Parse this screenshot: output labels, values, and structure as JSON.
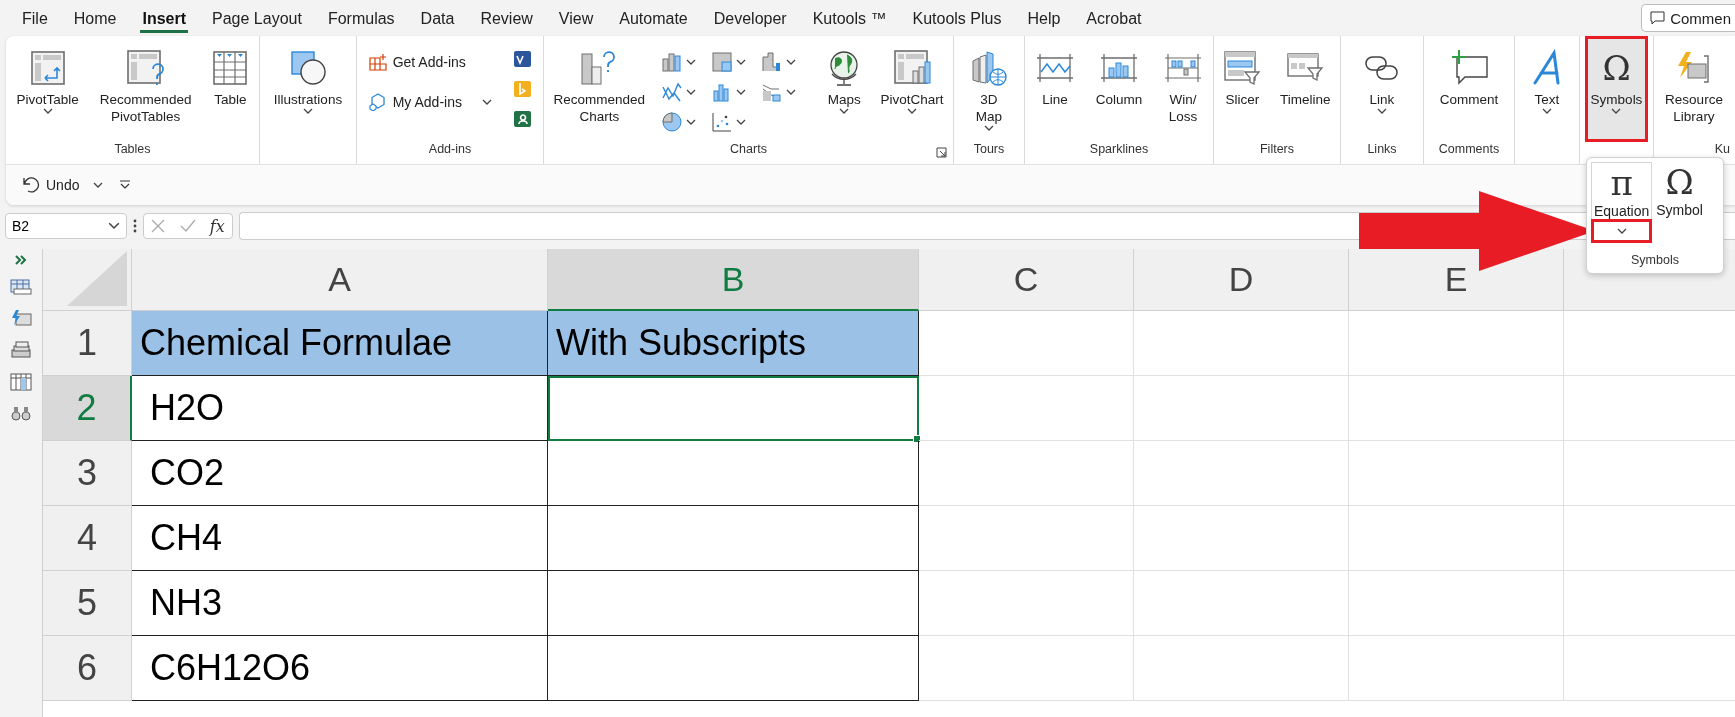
{
  "menu_tabs": [
    {
      "label": "File",
      "selected": false
    },
    {
      "label": "Home",
      "selected": false
    },
    {
      "label": "Insert",
      "selected": true
    },
    {
      "label": "Page Layout",
      "selected": false
    },
    {
      "label": "Formulas",
      "selected": false
    },
    {
      "label": "Data",
      "selected": false
    },
    {
      "label": "Review",
      "selected": false
    },
    {
      "label": "View",
      "selected": false
    },
    {
      "label": "Automate",
      "selected": false
    },
    {
      "label": "Developer",
      "selected": false
    },
    {
      "label": "Kutools ™",
      "selected": false
    },
    {
      "label": "Kutools Plus",
      "selected": false
    },
    {
      "label": "Help",
      "selected": false
    },
    {
      "label": "Acrobat",
      "selected": false
    }
  ],
  "comments_button": {
    "label": "Commen"
  },
  "ribbon": {
    "groups": [
      {
        "label": "Tables",
        "commands": [
          {
            "kind": "large",
            "label": "PivotTable",
            "dropdown": true,
            "pressed": false,
            "highlighted": false
          },
          {
            "kind": "large",
            "label": "Recommended\nPivotTables",
            "dropdown": false,
            "pressed": false,
            "highlighted": false
          },
          {
            "kind": "large",
            "label": "Table",
            "dropdown": false,
            "pressed": false,
            "highlighted": false
          }
        ]
      },
      {
        "commands": [
          {
            "kind": "large",
            "label": "Illustrations",
            "dropdown": true,
            "pressed": false,
            "highlighted": false
          }
        ]
      },
      {
        "label": "Add-ins",
        "commands": [
          {
            "kind": "small",
            "label": "Get Add-ins",
            "dropdown": false,
            "pressed": false,
            "highlighted": false
          },
          {
            "kind": "small",
            "label": "My Add-ins",
            "dropdown": true,
            "pressed": false,
            "highlighted": false
          },
          {
            "kind": "apps",
            "pressed": false,
            "highlighted": false
          }
        ]
      },
      {
        "label": "Charts",
        "launcher": true,
        "commands": [
          {
            "kind": "large",
            "label": "Recommended\nCharts",
            "dropdown": false,
            "pressed": false,
            "highlighted": false
          },
          {
            "kind": "gallery",
            "pressed": false,
            "highlighted": false
          },
          {
            "kind": "large",
            "label": "Maps",
            "dropdown": true,
            "pressed": false,
            "highlighted": false
          },
          {
            "kind": "large",
            "label": "PivotChart",
            "dropdown": true,
            "pressed": false,
            "highlighted": false
          }
        ]
      },
      {
        "label": "Tours",
        "commands": [
          {
            "kind": "large",
            "label": "3D\nMap",
            "dropdown": true,
            "pressed": false,
            "highlighted": false
          }
        ]
      },
      {
        "label": "Sparklines",
        "commands": [
          {
            "kind": "large",
            "label": "Line",
            "dropdown": false,
            "pressed": false,
            "highlighted": false
          },
          {
            "kind": "large",
            "label": "Column",
            "dropdown": false,
            "pressed": false,
            "highlighted": false
          },
          {
            "kind": "large",
            "label": "Win/\nLoss",
            "dropdown": false,
            "pressed": false,
            "highlighted": false
          }
        ]
      },
      {
        "label": "Filters",
        "commands": [
          {
            "kind": "large",
            "label": "Slicer",
            "dropdown": false,
            "pressed": false,
            "highlighted": false
          },
          {
            "kind": "large",
            "label": "Timeline",
            "dropdown": false,
            "pressed": false,
            "highlighted": false
          }
        ]
      },
      {
        "label": "Links",
        "commands": [
          {
            "kind": "large",
            "label": "Link",
            "dropdown": true,
            "pressed": false,
            "highlighted": false
          }
        ]
      },
      {
        "label": "Comments",
        "commands": [
          {
            "kind": "large",
            "label": "Comment",
            "dropdown": false,
            "pressed": false,
            "highlighted": false
          }
        ]
      },
      {
        "commands": [
          {
            "kind": "large",
            "label": "Text",
            "dropdown": true,
            "pressed": false,
            "highlighted": false
          }
        ]
      },
      {
        "commands": [
          {
            "kind": "large",
            "glyph": "Ω",
            "label": "Symbols",
            "dropdown": true,
            "pressed": true,
            "highlighted": true
          }
        ]
      },
      {
        "label": "Ku",
        "commands": [
          {
            "kind": "large",
            "label": "Resource\nLibrary",
            "dropdown": false,
            "pressed": false,
            "highlighted": false
          }
        ]
      }
    ]
  },
  "quick_access": {
    "undo_label": "Undo"
  },
  "symbols_menu": {
    "label": "Symbols",
    "items": [
      {
        "glyph": "π",
        "label": "Equation",
        "dropdown": true,
        "highlighted": true
      },
      {
        "glyph": "Ω",
        "label": "Symbol",
        "dropdown": false,
        "highlighted": false
      }
    ]
  },
  "formula_bar": {
    "name_box": "B2",
    "fx": "fx"
  },
  "sheet": {
    "columns": [
      {
        "label": "A",
        "selected": false
      },
      {
        "label": "B",
        "selected": true
      },
      {
        "label": "C",
        "selected": false
      },
      {
        "label": "D",
        "selected": false
      },
      {
        "label": "E",
        "selected": false
      },
      {
        "selected": false
      }
    ],
    "rows": [
      {
        "number": "1",
        "selected": false,
        "kind": "header",
        "cells": [
          "Chemical Formulae",
          "With Subscripts"
        ]
      },
      {
        "number": "2",
        "selected": true,
        "kind": "data",
        "cells": [
          "H2O"
        ]
      },
      {
        "number": "3",
        "selected": false,
        "kind": "data",
        "cells": [
          "CO2"
        ]
      },
      {
        "number": "4",
        "selected": false,
        "kind": "data",
        "cells": [
          "CH4"
        ]
      },
      {
        "number": "5",
        "selected": false,
        "kind": "data",
        "cells": [
          "NH3"
        ]
      },
      {
        "number": "6",
        "selected": false,
        "kind": "data",
        "cells": [
          "C6H12O6"
        ]
      }
    ]
  }
}
